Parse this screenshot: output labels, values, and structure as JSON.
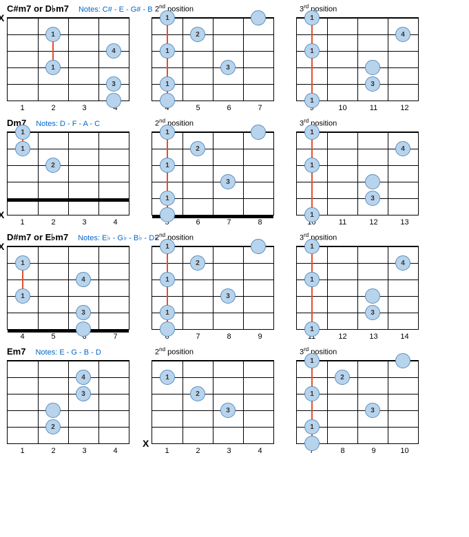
{
  "chart_data": [
    {
      "chord_name": "C#m7 or D♭m7",
      "notes_label": "Notes:",
      "notes": "C# - E - G# - B",
      "positions": [
        {
          "label": "",
          "frets": [
            1,
            2,
            3,
            4
          ],
          "muted_strings": [
            0
          ],
          "thick_string": null,
          "barre": null,
          "dots": [
            {
              "string": 1,
              "fret": 2,
              "finger": "1"
            },
            {
              "string": 2,
              "fret": 4,
              "finger": "4"
            },
            {
              "string": 3,
              "fret": 2,
              "finger": "1"
            },
            {
              "string": 4,
              "fret": 4,
              "finger": "3"
            },
            {
              "string": 5,
              "fret": 4,
              "finger": ""
            }
          ],
          "barre_line": {
            "from": 1,
            "to": 3,
            "fret": 2
          }
        },
        {
          "label": "2nd position",
          "frets": [
            4,
            5,
            6,
            7
          ],
          "muted_strings": [],
          "thick_string": null,
          "barre": {
            "fret": 4,
            "from": 0,
            "to": 5
          },
          "dots": [
            {
              "string": 0,
              "fret": 4,
              "finger": "1"
            },
            {
              "string": 0,
              "fret": 7,
              "finger": ""
            },
            {
              "string": 1,
              "fret": 5,
              "finger": "2"
            },
            {
              "string": 2,
              "fret": 4,
              "finger": "1"
            },
            {
              "string": 3,
              "fret": 6,
              "finger": "3"
            },
            {
              "string": 4,
              "fret": 4,
              "finger": "1"
            },
            {
              "string": 5,
              "fret": 4,
              "finger": ""
            }
          ]
        },
        {
          "label": "3rd position",
          "frets": [
            9,
            10,
            11,
            12
          ],
          "muted_strings": [],
          "thick_string": null,
          "barre": {
            "fret": 9,
            "from": 0,
            "to": 5
          },
          "dots": [
            {
              "string": 0,
              "fret": 9,
              "finger": "1"
            },
            {
              "string": 1,
              "fret": 12,
              "finger": "4"
            },
            {
              "string": 2,
              "fret": 9,
              "finger": "1"
            },
            {
              "string": 3,
              "fret": 11,
              "finger": ""
            },
            {
              "string": 4,
              "fret": 11,
              "finger": "3"
            },
            {
              "string": 5,
              "fret": 9,
              "finger": "1"
            }
          ]
        }
      ]
    },
    {
      "chord_name": "Dm7",
      "notes_label": "Notes:",
      "notes": "D - F - A - C",
      "positions": [
        {
          "label": "",
          "frets": [
            1,
            2,
            3,
            4
          ],
          "muted_strings": [
            5
          ],
          "thick_string": 4,
          "barre": null,
          "dots": [
            {
              "string": 0,
              "fret": 1,
              "finger": "1"
            },
            {
              "string": 1,
              "fret": 1,
              "finger": "1"
            },
            {
              "string": 2,
              "fret": 2,
              "finger": "2"
            }
          ],
          "barre_line": {
            "from": 0,
            "to": 1,
            "fret": 1
          }
        },
        {
          "label": "2nd position",
          "frets": [
            5,
            6,
            7,
            8
          ],
          "muted_strings": [],
          "thick_string": 5,
          "barre": {
            "fret": 5,
            "from": 0,
            "to": 5
          },
          "dots": [
            {
              "string": 0,
              "fret": 5,
              "finger": "1"
            },
            {
              "string": 0,
              "fret": 8,
              "finger": ""
            },
            {
              "string": 1,
              "fret": 6,
              "finger": "2"
            },
            {
              "string": 2,
              "fret": 5,
              "finger": "1"
            },
            {
              "string": 3,
              "fret": 7,
              "finger": "3"
            },
            {
              "string": 4,
              "fret": 5,
              "finger": "1"
            },
            {
              "string": 5,
              "fret": 5,
              "finger": ""
            }
          ]
        },
        {
          "label": "3rd position",
          "frets": [
            10,
            11,
            12,
            13
          ],
          "muted_strings": [],
          "thick_string": null,
          "barre": {
            "fret": 10,
            "from": 0,
            "to": 5
          },
          "dots": [
            {
              "string": 0,
              "fret": 10,
              "finger": "1"
            },
            {
              "string": 1,
              "fret": 13,
              "finger": "4"
            },
            {
              "string": 2,
              "fret": 10,
              "finger": "1"
            },
            {
              "string": 3,
              "fret": 12,
              "finger": ""
            },
            {
              "string": 4,
              "fret": 12,
              "finger": "3"
            },
            {
              "string": 5,
              "fret": 10,
              "finger": "1"
            }
          ]
        }
      ]
    },
    {
      "chord_name": "D#m7 or E♭m7",
      "notes_label": "Notes:",
      "notes": "E♭ - G♭ - B♭ - D♭",
      "positions": [
        {
          "label": "",
          "frets": [
            4,
            5,
            6,
            7
          ],
          "muted_strings": [
            0
          ],
          "thick_string": 5,
          "barre": null,
          "dots": [
            {
              "string": 1,
              "fret": 4,
              "finger": "1"
            },
            {
              "string": 2,
              "fret": 6,
              "finger": "4"
            },
            {
              "string": 3,
              "fret": 4,
              "finger": "1"
            },
            {
              "string": 4,
              "fret": 6,
              "finger": "3"
            },
            {
              "string": 5,
              "fret": 6,
              "finger": ""
            }
          ],
          "barre_line": {
            "from": 1,
            "to": 3,
            "fret": 4
          }
        },
        {
          "label": "2nd position",
          "frets": [
            6,
            7,
            8,
            9
          ],
          "muted_strings": [],
          "thick_string": null,
          "barre": {
            "fret": 6,
            "from": 0,
            "to": 5
          },
          "dots": [
            {
              "string": 0,
              "fret": 6,
              "finger": "1"
            },
            {
              "string": 0,
              "fret": 9,
              "finger": ""
            },
            {
              "string": 1,
              "fret": 7,
              "finger": "2"
            },
            {
              "string": 2,
              "fret": 6,
              "finger": "1"
            },
            {
              "string": 3,
              "fret": 8,
              "finger": "3"
            },
            {
              "string": 4,
              "fret": 6,
              "finger": "1"
            },
            {
              "string": 5,
              "fret": 6,
              "finger": ""
            }
          ]
        },
        {
          "label": "3rd position",
          "frets": [
            11,
            12,
            13,
            14
          ],
          "muted_strings": [],
          "thick_string": null,
          "barre": {
            "fret": 11,
            "from": 0,
            "to": 5
          },
          "dots": [
            {
              "string": 0,
              "fret": 11,
              "finger": "1"
            },
            {
              "string": 1,
              "fret": 14,
              "finger": "4"
            },
            {
              "string": 2,
              "fret": 11,
              "finger": "1"
            },
            {
              "string": 3,
              "fret": 13,
              "finger": ""
            },
            {
              "string": 4,
              "fret": 13,
              "finger": "3"
            },
            {
              "string": 5,
              "fret": 11,
              "finger": "1"
            }
          ]
        }
      ]
    },
    {
      "chord_name": "Em7",
      "notes_label": "Notes:",
      "notes": "E - G - B - D",
      "positions": [
        {
          "label": "",
          "frets": [
            1,
            2,
            3,
            4
          ],
          "muted_strings": [],
          "thick_string": null,
          "barre": null,
          "dots": [
            {
              "string": 1,
              "fret": 3,
              "finger": "4"
            },
            {
              "string": 2,
              "fret": 3,
              "finger": "3"
            },
            {
              "string": 3,
              "fret": 2,
              "finger": ""
            },
            {
              "string": 4,
              "fret": 2,
              "finger": "2"
            }
          ]
        },
        {
          "label": "2nd position",
          "frets": [
            1,
            2,
            3,
            4
          ],
          "muted_strings": [
            5
          ],
          "thick_string": null,
          "barre": null,
          "dots": [
            {
              "string": 1,
              "fret": 1,
              "finger": "1"
            },
            {
              "string": 2,
              "fret": 2,
              "finger": "2"
            },
            {
              "string": 3,
              "fret": 3,
              "finger": "3"
            }
          ]
        },
        {
          "label": "3rd position",
          "frets": [
            7,
            8,
            9,
            10
          ],
          "muted_strings": [],
          "thick_string": null,
          "barre": {
            "fret": 7,
            "from": 0,
            "to": 5
          },
          "dots": [
            {
              "string": 0,
              "fret": 7,
              "finger": "1"
            },
            {
              "string": 0,
              "fret": 10,
              "finger": ""
            },
            {
              "string": 1,
              "fret": 8,
              "finger": "2"
            },
            {
              "string": 2,
              "fret": 7,
              "finger": "1"
            },
            {
              "string": 3,
              "fret": 9,
              "finger": "3"
            },
            {
              "string": 4,
              "fret": 7,
              "finger": "1"
            },
            {
              "string": 5,
              "fret": 7,
              "finger": ""
            }
          ]
        }
      ]
    }
  ]
}
